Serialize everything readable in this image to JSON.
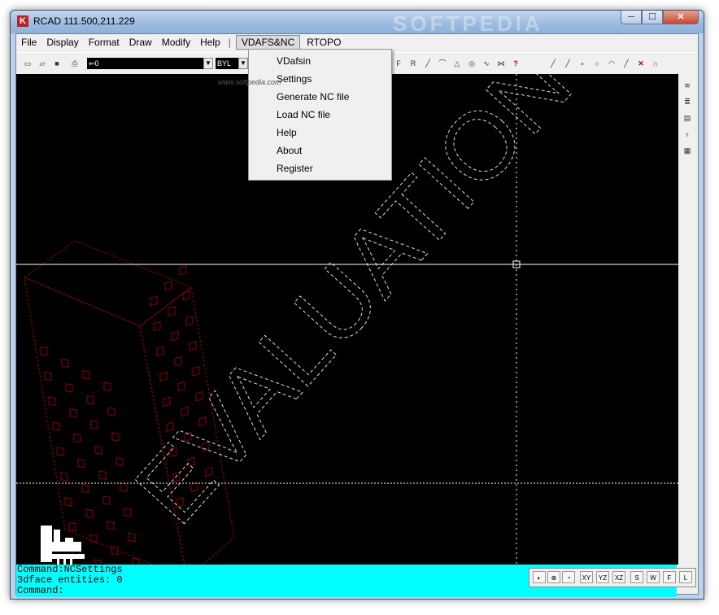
{
  "window": {
    "title": "RCAD  111.500,211.229",
    "watermark": "SOFTPEDIA",
    "controls": {
      "minimize": "─",
      "maximize": "☐",
      "close": "✕"
    }
  },
  "menubar": {
    "items": [
      "File",
      "Display",
      "Format",
      "Draw",
      "Modify",
      "Help",
      "|",
      "VDAFS&NC",
      "RTOPO"
    ]
  },
  "toolbar": {
    "layer_value": "⇐0",
    "linetype_value": "BYL",
    "tool_icons": [
      "new-icon",
      "open-icon",
      "save-icon",
      "print-icon",
      "zoom-icon",
      "text-icon",
      "point-icon",
      "line-icon",
      "polyline-icon",
      "arc-icon",
      "circle-icon",
      "spline-icon",
      "help-icon"
    ],
    "right_icons": [
      "trim-icon",
      "extend-icon",
      "fillet-icon",
      "circle-tool-icon",
      "arc-tool-icon",
      "break-icon",
      "delete-icon",
      "undo-icon"
    ]
  },
  "dropdown": {
    "items": [
      "VDafsin",
      "Settings",
      "Generate NC file",
      "Load NC file",
      "Help",
      "About",
      "Register"
    ]
  },
  "softpedia_url": "www.softpedia.com",
  "canvas": {
    "watermark_text": "EVALUATION",
    "crosshair_color": "#ffffff",
    "building_color": "#8b0000"
  },
  "command": {
    "lines": [
      "Command:NCSettings",
      "3dface entities: 0",
      "Command:"
    ]
  },
  "viewbar": {
    "buttons": [
      "zoom-in-icon",
      "zoom-pan-icon",
      "zoom-all-icon",
      "XY",
      "YZ",
      "XZ",
      "S",
      "W",
      "F",
      "L"
    ]
  },
  "colors": {
    "command_bg": "#00ffff",
    "canvas_bg": "#000000",
    "menu_bg": "#f0f0f0"
  }
}
